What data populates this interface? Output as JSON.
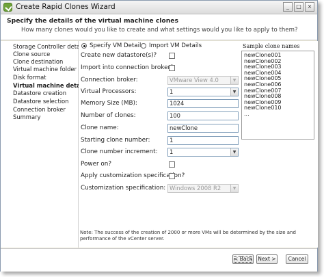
{
  "window": {
    "title": "Create Rapid Clones Wizard",
    "controls": {
      "minimize": "_",
      "maximize": "□",
      "close": "×"
    }
  },
  "header": {
    "title": "Specify the details of the virtual machine clones",
    "subtitle": "How many clones would you like to create and what settings would you like to apply to them?"
  },
  "steps": [
    {
      "label": "Storage Controller details",
      "active": false
    },
    {
      "label": "Clone source",
      "active": false
    },
    {
      "label": "Clone destination",
      "active": false
    },
    {
      "label": "Virtual machine folder",
      "active": false
    },
    {
      "label": "Disk format",
      "active": false
    },
    {
      "label": "Virtual machine details",
      "active": true
    },
    {
      "label": "Datastore creation",
      "active": false
    },
    {
      "label": "Datastore selection",
      "active": false
    },
    {
      "label": "Connection broker",
      "active": false
    },
    {
      "label": "Summary",
      "active": false
    }
  ],
  "mode": {
    "specify_label": "Specify VM Details",
    "import_label": "Import VM Details",
    "selected": "specify"
  },
  "form": {
    "create_datastore_label": "Create new datastore(s)?",
    "create_datastore_checked": false,
    "import_broker_label": "Import into connection broker?",
    "import_broker_checked": false,
    "connection_broker_label": "Connection broker:",
    "connection_broker_value": "VMware View 4.0",
    "virtual_processors_label": "Virtual Processors:",
    "virtual_processors_value": "1",
    "memory_label": "Memory Size (MB):",
    "memory_value": "1024",
    "num_clones_label": "Number of clones:",
    "num_clones_value": "100",
    "clone_name_label": "Clone name:",
    "clone_name_value": "newClone",
    "start_number_label": "Starting clone number:",
    "start_number_value": "1",
    "increment_label": "Clone number increment:",
    "increment_value": "1",
    "power_on_label": "Power on?",
    "power_on_checked": false,
    "apply_custom_label": "Apply customization specification?",
    "apply_custom_checked": false,
    "custom_spec_label": "Customization specification:",
    "custom_spec_value": "Windows 2008 R2"
  },
  "sample": {
    "title": "Sample clone names",
    "names": [
      "newClone001",
      "newClone002",
      "newClone003",
      "newClone004",
      "newClone005",
      "newClone006",
      "newClone007",
      "newClone008",
      "newClone009",
      "newClone010",
      "..."
    ]
  },
  "note": "Note: The success of the creation of 2000 or more VMs will be determined by the size and performance of the vCenter server.",
  "footer": {
    "back_label": "< Back",
    "next_label": "Next >",
    "cancel_label": "Cancel"
  }
}
